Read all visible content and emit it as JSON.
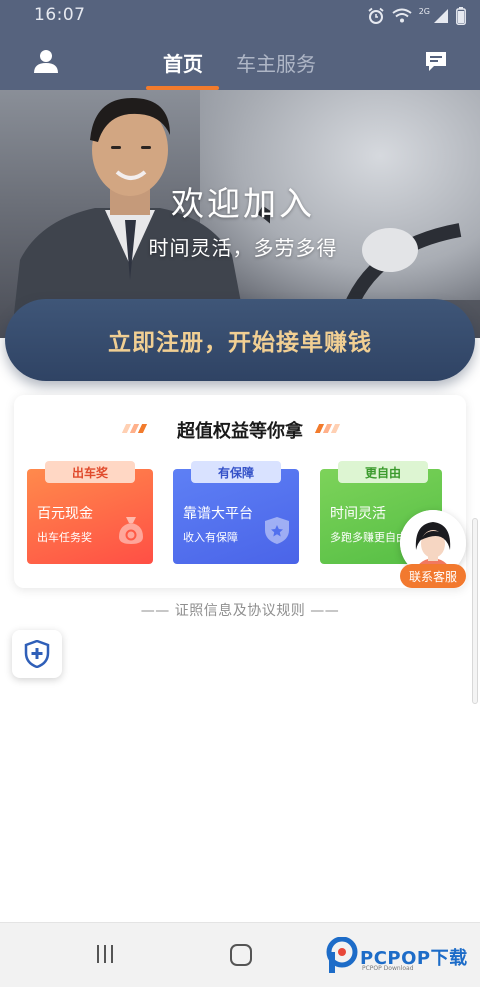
{
  "status_bar": {
    "time": "16:07",
    "network_label": "2G"
  },
  "header": {
    "tabs": [
      {
        "label": "首页",
        "active": true
      },
      {
        "label": "车主服务",
        "active": false
      }
    ],
    "accent_color": "#f27b2c",
    "background_color": "#56637e"
  },
  "hero": {
    "title": "欢迎加入",
    "subtitle": "时间灵活，多劳多得",
    "register_label": "立即注册，开始接单赚钱"
  },
  "benefits": {
    "title": "超值权益等你拿",
    "items": [
      {
        "tag": "出车奖",
        "name": "百元现金",
        "desc": "出车任务奖",
        "icon": "money-bag-icon",
        "color": "#ff5f47"
      },
      {
        "tag": "有保障",
        "name": "靠谱大平台",
        "desc": "收入有保障",
        "icon": "shield-icon",
        "color": "#5270ee"
      },
      {
        "tag": "更自由",
        "name": "时间灵活",
        "desc": "多跑多赚更自由",
        "icon": "clock-icon",
        "color": "#62c64c"
      }
    ]
  },
  "contact": {
    "label": "联系客服"
  },
  "license_link": "—— 证照信息及协议规则 ——",
  "watermark": {
    "text": "PCPOP下载",
    "sub": "PCPOP Download"
  }
}
